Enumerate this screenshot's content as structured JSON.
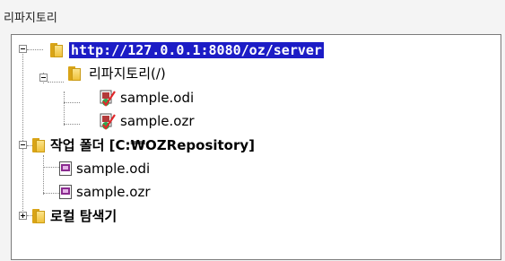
{
  "panel": {
    "title": "리파지토리"
  },
  "tree": {
    "server": {
      "label": "http://127.0.0.1:8080/oz/server"
    },
    "repository": {
      "label": "리파지토리(/)",
      "files": [
        {
          "label": "sample.odi"
        },
        {
          "label": "sample.ozr"
        }
      ]
    },
    "work_folder": {
      "label": "작업 폴더 [C:₩OZRepository]",
      "files": [
        {
          "label": "sample.odi"
        },
        {
          "label": "sample.ozr"
        }
      ]
    },
    "local_explorer": {
      "label": "로컬 탐색기"
    }
  },
  "icons": {
    "folder": "folder-icon",
    "checked_doc": "checked-document-icon",
    "doc": "document-icon"
  },
  "colors": {
    "selection": "#1c1cc6",
    "folder": "#f0c23b",
    "check": "#2fa84f"
  }
}
